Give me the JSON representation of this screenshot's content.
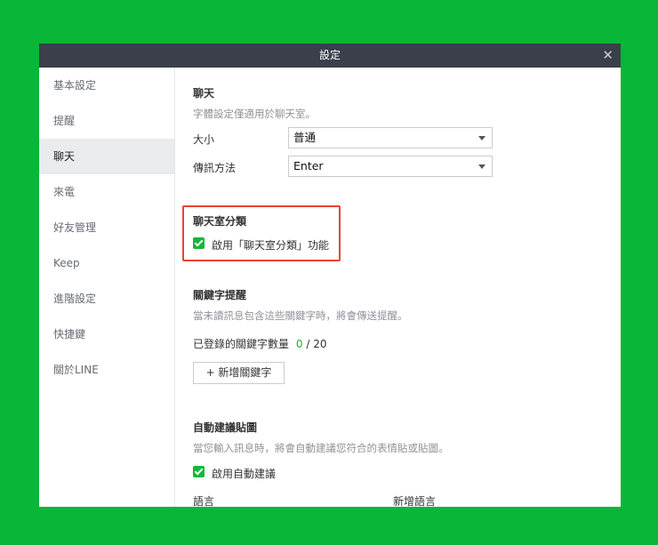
{
  "window": {
    "title": "設定",
    "close_glyph": "✕"
  },
  "sidebar": {
    "items": [
      {
        "label": "基本設定"
      },
      {
        "label": "提醒"
      },
      {
        "label": "聊天"
      },
      {
        "label": "來電"
      },
      {
        "label": "好友管理"
      },
      {
        "label": "Keep"
      },
      {
        "label": "進階設定"
      },
      {
        "label": "快捷鍵"
      },
      {
        "label": "關於LINE"
      }
    ],
    "active": "聊天"
  },
  "chat": {
    "title": "聊天",
    "desc": "字體設定僅適用於聊天室。",
    "size_label": "大小",
    "size_value": "普通",
    "send_label": "傳訊方法",
    "send_value": "Enter"
  },
  "category": {
    "title": "聊天室分類",
    "checkbox_label": "啟用「聊天室分類」功能",
    "checked": true,
    "highlight_color": "#ea4335"
  },
  "keyword": {
    "title": "關鍵字提醒",
    "desc": "當未讀訊息包含這些關鍵字時，將會傳送提醒。",
    "count_label": "已登錄的關鍵字數量",
    "count_current": "0",
    "count_sep": "/",
    "count_max": "20",
    "add_button": "+ 新增關鍵字"
  },
  "sticker": {
    "title": "自動建議貼圖",
    "desc": "當您輸入訊息時，將會自動建議您符合的表情貼或貼圖。",
    "checkbox_label": "啟用自動建議",
    "checked": true,
    "col_language": "語言",
    "col_add_language": "新增語言"
  },
  "colors": {
    "accent": "#15b738",
    "titlebar": "#3a3f4b",
    "background": "#0ab637"
  }
}
